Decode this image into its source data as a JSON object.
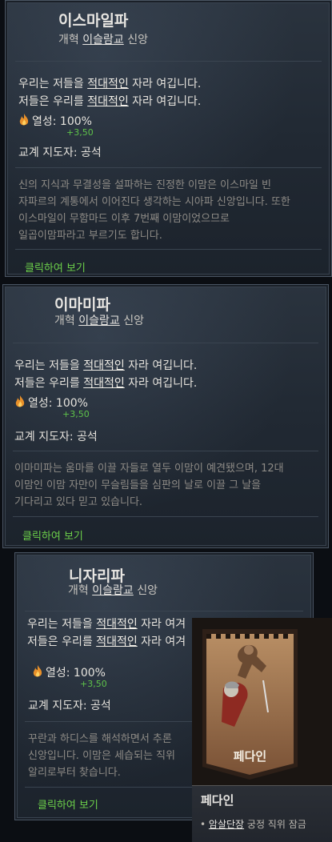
{
  "cards": [
    {
      "title": "이스마일파",
      "subtitle_prefix": "개혁",
      "subtitle_link": "이슬람교",
      "subtitle_suffix": "신앙",
      "moon_color": "#8f86c8",
      "line1_a": "우리는 저들을",
      "line1_u": "적대적인",
      "line1_b": "자라 여깁니다.",
      "line2_a": "저들은 우리를",
      "line2_u": "적대적인",
      "line2_b": "자라 여깁니다.",
      "fervor": "열성: 100%",
      "fervor_bonus": "+3,50",
      "leader": "교계 지도자: 공석",
      "desc_lines": [
        "신의 지식과 무결성을 설파하는 진정한 이맘은 이스마일 빈",
        "자파르의 계통에서 이어진다 생각하는 시아파 신앙입니다. 또한",
        "이스마일이 무함마드 이후 7번째 이맘이었으므로",
        "일곱이맘파라고 부르기도 합니다."
      ],
      "click": "클릭하여 보기"
    },
    {
      "title": "이마미파",
      "subtitle_prefix": "개혁",
      "subtitle_link": "이슬람교",
      "subtitle_suffix": "신앙",
      "moon_color": "#4f9a92",
      "line1_a": "우리는 저들을",
      "line1_u": "적대적인",
      "line1_b": "자라 여깁니다.",
      "line2_a": "저들은 우리를",
      "line2_u": "적대적인",
      "line2_b": "자라 여깁니다.",
      "fervor": "열성: 100%",
      "fervor_bonus": "+3,50",
      "leader": "교계 지도자: 공석",
      "desc_lines": [
        "이마미파는 움마를 이끌 자들로 열두 이맘이 예견됐으며, 12대",
        "이맘인 이맘 자만이 무슬림들을 심판의 날로 이끌 그 날을",
        "기다리고 있다 믿고 있습니다."
      ],
      "click": "클릭하여 보기"
    },
    {
      "title": "니자리파",
      "subtitle_prefix": "개혁",
      "subtitle_link": "이슬람교",
      "subtitle_suffix": "신앙",
      "moon_color": "#b66b4e",
      "line1_a": "우리는 저들을",
      "line1_u": "적대적인",
      "line1_b": "자라 여겨",
      "line2_a": "저들은 우리를",
      "line2_u": "적대적인",
      "line2_b": "자라 여겨",
      "fervor": "열성: 100%",
      "fervor_bonus": "+3,50",
      "leader": "교계 지도자: 공석",
      "desc_lines": [
        "꾸란과 하디스를 해석하면서 추론",
        "신앙입니다. 이맘은 세습되는 직위",
        "알리로부터 찾습니다."
      ],
      "click": "클릭하여 보기"
    }
  ],
  "popup": {
    "banner_label": "페다인",
    "title": "페다인",
    "bullet": "•",
    "line_link": "암살단장",
    "line_rest": "궁정 직위 잠금"
  }
}
